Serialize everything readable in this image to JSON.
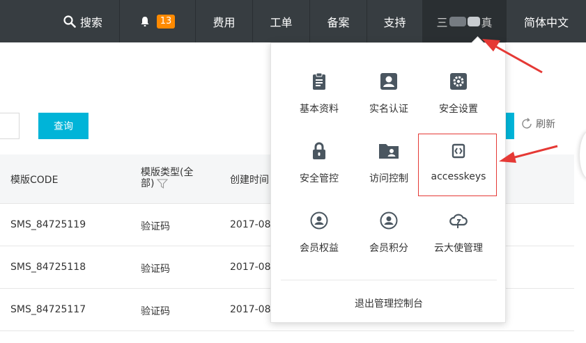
{
  "topbar": {
    "search_label": "搜索",
    "notifications_count": "13",
    "fees": "费用",
    "tickets": "工单",
    "filing": "备案",
    "support": "支持",
    "account_prefix": "三",
    "account_suffix": "真",
    "language": "简体中文"
  },
  "toolbar": {
    "query_button": "查询",
    "refresh_label": "刷新"
  },
  "table": {
    "headers": {
      "code": "模版CODE",
      "type_line1": "模版类型(全",
      "type_line2": "部)",
      "created": "创建时间"
    },
    "rows": [
      {
        "code": "SMS_84725119",
        "type": "验证码",
        "created": "2017-08"
      },
      {
        "code": "SMS_84725118",
        "type": "验证码",
        "created": "2017-08"
      },
      {
        "code": "SMS_84725117",
        "type": "验证码",
        "created": "2017-08"
      }
    ]
  },
  "dropdown": {
    "items": [
      {
        "label": "基本资料",
        "icon": "clipboard-icon"
      },
      {
        "label": "实名认证",
        "icon": "id-card-icon"
      },
      {
        "label": "安全设置",
        "icon": "gear-icon"
      },
      {
        "label": "安全管控",
        "icon": "lock-icon"
      },
      {
        "label": "访问控制",
        "icon": "folder-user-icon"
      },
      {
        "label": "accesskeys",
        "icon": "key-code-icon"
      },
      {
        "label": "会员权益",
        "icon": "member-icon"
      },
      {
        "label": "会员积分",
        "icon": "member-points-icon"
      },
      {
        "label": "云大使管理",
        "icon": "cloud-icon"
      }
    ],
    "logout": "退出管理控制台"
  },
  "colors": {
    "topbar_bg": "#373d41",
    "accent": "#00b4d8",
    "badge": "#ff8a00",
    "highlight": "#e53935"
  }
}
